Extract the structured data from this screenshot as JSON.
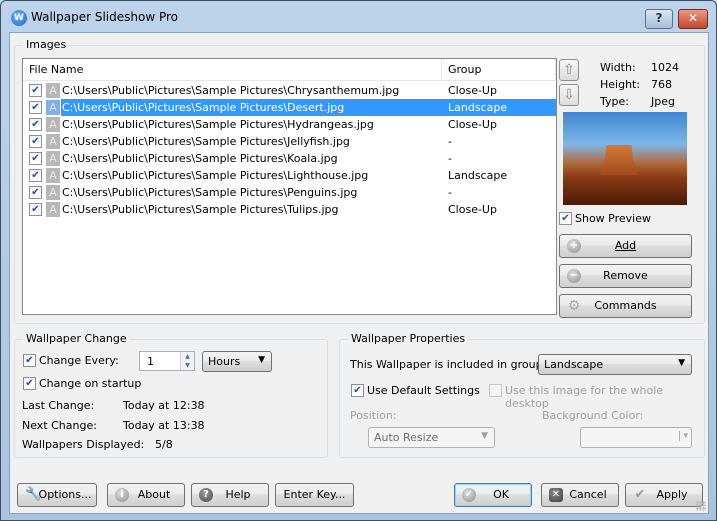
{
  "window": {
    "title": "Wallpaper Slideshow Pro",
    "help_label": "?",
    "close_label": "✕"
  },
  "images": {
    "group_title": "Images",
    "columns": {
      "file_name": "File Name",
      "group": "Group"
    },
    "rows": [
      {
        "checked": true,
        "path": "C:\\Users\\Public\\Pictures\\Sample Pictures\\Chrysanthemum.jpg",
        "group": "Close-Up",
        "selected": false
      },
      {
        "checked": true,
        "path": "C:\\Users\\Public\\Pictures\\Sample Pictures\\Desert.jpg",
        "group": "Landscape",
        "selected": true
      },
      {
        "checked": true,
        "path": "C:\\Users\\Public\\Pictures\\Sample Pictures\\Hydrangeas.jpg",
        "group": "Close-Up",
        "selected": false
      },
      {
        "checked": true,
        "path": "C:\\Users\\Public\\Pictures\\Sample Pictures\\Jellyfish.jpg",
        "group": "-",
        "selected": false
      },
      {
        "checked": true,
        "path": "C:\\Users\\Public\\Pictures\\Sample Pictures\\Koala.jpg",
        "group": "-",
        "selected": false
      },
      {
        "checked": true,
        "path": "C:\\Users\\Public\\Pictures\\Sample Pictures\\Lighthouse.jpg",
        "group": "Landscape",
        "selected": false
      },
      {
        "checked": true,
        "path": "C:\\Users\\Public\\Pictures\\Sample Pictures\\Penguins.jpg",
        "group": "-",
        "selected": false
      },
      {
        "checked": true,
        "path": "C:\\Users\\Public\\Pictures\\Sample Pictures\\Tulips.jpg",
        "group": "Close-Up",
        "selected": false
      }
    ],
    "attr_glyph": "A",
    "move_up_glyph": "⇧",
    "move_down_glyph": "⇩",
    "info": {
      "width_label": "Width:",
      "width_value": "1024",
      "height_label": "Height:",
      "height_value": "768",
      "type_label": "Type:",
      "type_value": "Jpeg"
    },
    "show_preview": {
      "label": "Show Preview",
      "checked": true
    },
    "add_label": "Add",
    "remove_label": "Remove",
    "commands_label": "Commands"
  },
  "wallpaper_change": {
    "group_title": "Wallpaper Change",
    "change_every": {
      "label": "Change Every:",
      "checked": true,
      "value": "1",
      "unit": "Hours"
    },
    "change_on_startup": {
      "label": "Change on startup",
      "checked": true
    },
    "last_change_label": "Last Change:",
    "last_change_value": "Today at 12:38",
    "next_change_label": "Next Change:",
    "next_change_value": "Today at 13:38",
    "displayed_label": "Wallpapers Displayed:",
    "displayed_value": "5/8"
  },
  "wallpaper_properties": {
    "group_title": "Wallpaper Properties",
    "included_label": "This Wallpaper is included in group:",
    "included_value": "Landscape",
    "use_default": {
      "label": "Use Default Settings",
      "checked": true
    },
    "whole_desktop": {
      "label": "Use this image for the whole desktop",
      "checked": false
    },
    "position_label": "Position:",
    "position_value": "Auto Resize",
    "bg_color_label": "Background Color:",
    "bg_color_value": ""
  },
  "footer": {
    "options_label": "Options...",
    "about_label": "About",
    "help_label": "Help",
    "enter_key_label": "Enter Key...",
    "ok_label": "OK",
    "cancel_label": "Cancel",
    "apply_label": "Apply"
  },
  "colors": {
    "selection": "#3399ff",
    "title_bar": "#bcd3ea",
    "close_button": "#c6442c"
  }
}
